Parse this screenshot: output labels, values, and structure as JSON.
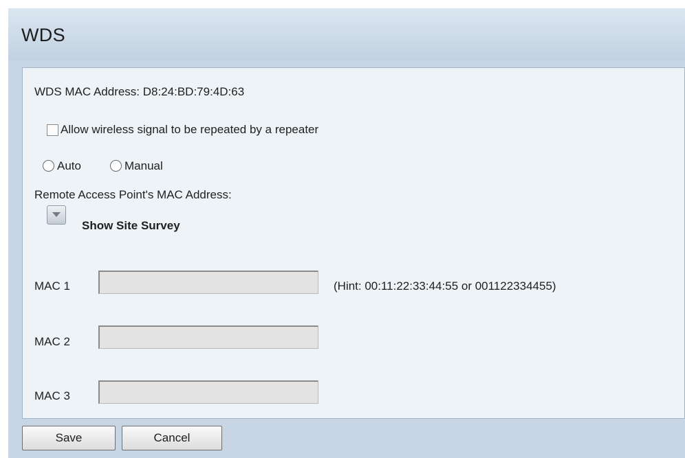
{
  "page_title": "WDS",
  "wds": {
    "mac_address_label": "WDS MAC Address: D8:24:BD:79:4D:63",
    "allow_repeat_label": "Allow wireless signal to be repeated by a repeater",
    "allow_repeat_checked": false,
    "mode_options": [
      "Auto",
      "Manual"
    ],
    "remote_ap_label": "Remote Access Point's MAC Address:",
    "site_survey_label": "Show Site Survey",
    "mac_fields": [
      {
        "label": "MAC 1",
        "value": ""
      },
      {
        "label": "MAC 2",
        "value": ""
      },
      {
        "label": "MAC 3",
        "value": ""
      }
    ],
    "hint": "(Hint: 00:11:22:33:44:55 or 001122334455)"
  },
  "actions": {
    "save_label": "Save",
    "cancel_label": "Cancel"
  },
  "icons": {
    "site_survey_toggle": "triangle-down-icon"
  },
  "colors": {
    "page_background": "#c7d5e4",
    "panel_background": "#eef3f7",
    "input_background": "#e3e3e3"
  }
}
